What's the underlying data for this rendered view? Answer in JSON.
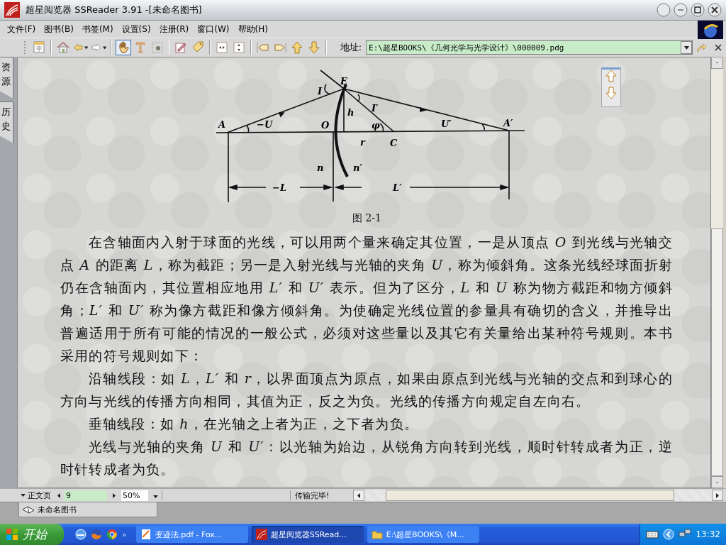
{
  "window": {
    "title": "超星阅览器 SSReader 3.91 -[未命名图书]"
  },
  "menu": [
    "文件(F)",
    "图书(B)",
    "书签(M)",
    "设置(S)",
    "注册(R)",
    "窗口(W)",
    "帮助(H)"
  ],
  "toolbar": {
    "tools": [
      {
        "kind": "panel",
        "selected": false
      },
      {
        "kind": "home",
        "selected": false
      },
      {
        "kind": "back",
        "selected": false
      },
      {
        "kind": "forward",
        "selected": false
      },
      {
        "kind": "hand",
        "selected": true
      },
      {
        "kind": "text",
        "selected": false
      },
      {
        "kind": "select",
        "selected": false
      },
      {
        "kind": "note",
        "selected": false
      },
      {
        "kind": "tag",
        "selected": false
      },
      {
        "kind": "fit-width",
        "selected": false
      },
      {
        "kind": "fit-height",
        "selected": false
      },
      {
        "kind": "prev-page",
        "selected": false
      },
      {
        "kind": "next-page",
        "selected": false
      },
      {
        "kind": "up",
        "selected": false
      },
      {
        "kind": "down",
        "selected": false
      }
    ],
    "address_label": "地址:",
    "address": "E:\\超星BOOKS\\《几何光学与光学设计》\\000009.pdg"
  },
  "side_tabs": [
    "资源",
    "历史"
  ],
  "page": {
    "figure": {
      "labels": [
        "E",
        "I",
        "h",
        "I′",
        "A",
        "−U",
        "O",
        "φ",
        "U′",
        "A′",
        "r",
        "C",
        "n",
        "n′",
        "−L",
        "L′"
      ],
      "caption": "图 2-1"
    },
    "paragraphs": [
      "在含轴面内入射于球面的光线，可以用两个量来确定其位置，一是从顶点 *O* 到光线与光轴交点 *A* 的距离 *L*，称为截距；另一是入射光线与光轴的夹角 *U*，称为倾斜角。这条光线经球面折射仍在含轴面内，其位置相应地用 *L′* 和 *U′* 表示。但为了区分，*L* 和 *U* 称为物方截距和物方倾斜角；*L′* 和 *U′* 称为像方截距和像方倾斜角。为使确定光线位置的参量具有确切的含义，并推导出普遍适用于所有可能的情况的一般公式，必须对这些量以及其它有关量给出某种符号规则。本书采用的符号规则如下：",
      "沿轴线段：如 *L*，*L′* 和 *r*，以界面顶点为原点，如果由原点到光线与光轴的交点和到球心的方向与光线的传播方向相同，其值为正，反之为负。光线的传播方向规定自左向右。",
      "垂轴线段：如 *h*，在光轴之上者为正，之下者为负。",
      "光线与光轴的夹角 *U* 和 *U′*：以光轴为始边，从锐角方向转到光线，顺时针转成者为正，逆时针转成者为负。"
    ]
  },
  "status_bar": {
    "page_type": "正文页",
    "page_number": "9",
    "zoom": "50%",
    "message": "传输完毕!"
  },
  "doc_tabs": [
    {
      "label": "未命名图书"
    }
  ],
  "taskbar": {
    "start": "开始",
    "more": "»",
    "tasks": [
      {
        "kind": "pdf",
        "label": "变迹法.pdf - Fox...",
        "selected": false
      },
      {
        "kind": "reader",
        "label": "超星阅览器SSRead...",
        "selected": true
      },
      {
        "kind": "folder",
        "label": "E:\\超星BOOKS\\《M...",
        "selected": false
      }
    ],
    "clock": "13:32"
  }
}
